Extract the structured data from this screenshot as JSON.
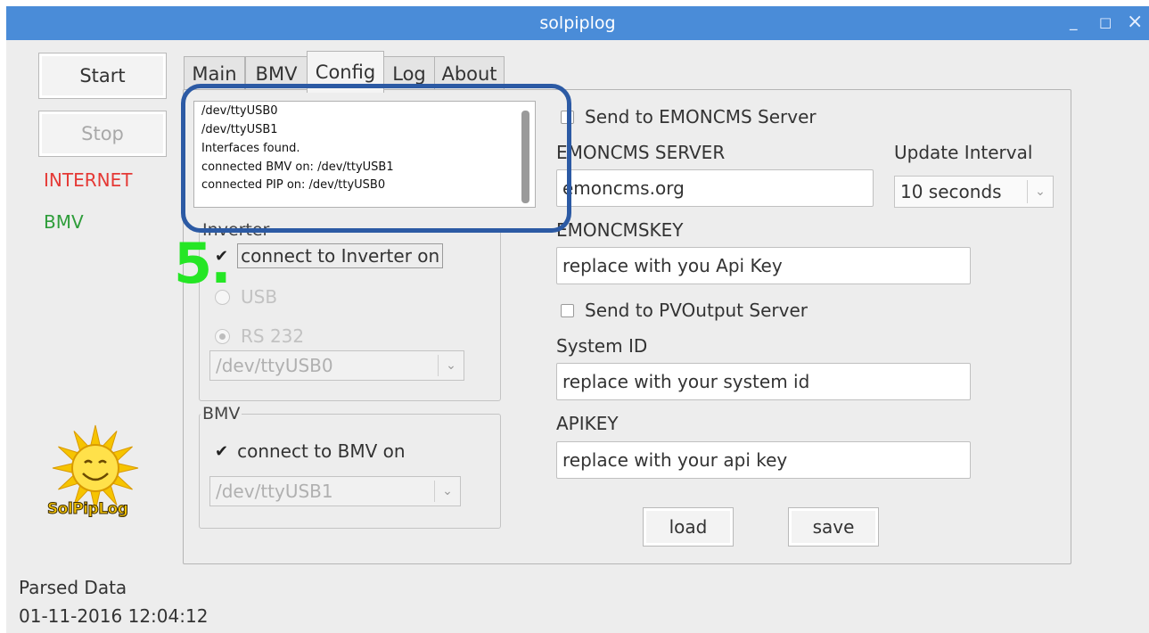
{
  "window": {
    "title": "solpiplog",
    "minimize": "_",
    "maximize": "□",
    "close": "×"
  },
  "left": {
    "start_label": "Start",
    "stop_label": "Stop",
    "internet_label": "INTERNET",
    "bmv_label": "BMV",
    "logo_text": "SolPipLog",
    "parsed_label": "Parsed Data",
    "timestamp": "01-11-2016 12:04:12",
    "colors": {
      "internet": "#e53935",
      "bmv": "#2e9d3a"
    }
  },
  "tabs": [
    {
      "label": "Main",
      "active": false
    },
    {
      "label": "BMV",
      "active": false
    },
    {
      "label": "Config",
      "active": true
    },
    {
      "label": "Log",
      "active": false
    },
    {
      "label": "About",
      "active": false
    }
  ],
  "log_lines": [
    "/dev/ttyUSB0",
    "/dev/ttyUSB1",
    "Interfaces found.",
    "connected BMV on: /dev/ttyUSB1",
    "connected PIP on: /dev/ttyUSB0"
  ],
  "annotation": {
    "step_label": "5.",
    "color": "#25e625",
    "highlight_color": "#2c5aa4"
  },
  "inverter": {
    "group_label": "Inverter",
    "connect_label": "connect to Inverter on",
    "connect_checked": true,
    "usb_label": "USB",
    "rs232_label": "RS 232",
    "selected": "RS 232",
    "port": "/dev/ttyUSB0"
  },
  "bmv": {
    "group_label": "BMV",
    "connect_label": "connect to BMV on",
    "connect_checked": true,
    "port": "/dev/ttyUSB1"
  },
  "emoncms": {
    "send_label": "Send to EMONCMS Server",
    "send_checked": false,
    "server_label": "EMONCMS SERVER",
    "server_value": "emoncms.org",
    "interval_label": "Update Interval",
    "interval_value": "10 seconds",
    "key_label": "EMONCMSKEY",
    "key_value": "replace with you Api Key"
  },
  "pvoutput": {
    "send_label": "Send to PVOutput Server",
    "send_checked": false,
    "system_label": "System ID",
    "system_value": "replace with your system id",
    "apikey_label": "APIKEY",
    "apikey_value": "replace with your api key"
  },
  "actions": {
    "load_label": "load",
    "save_label": "save"
  }
}
